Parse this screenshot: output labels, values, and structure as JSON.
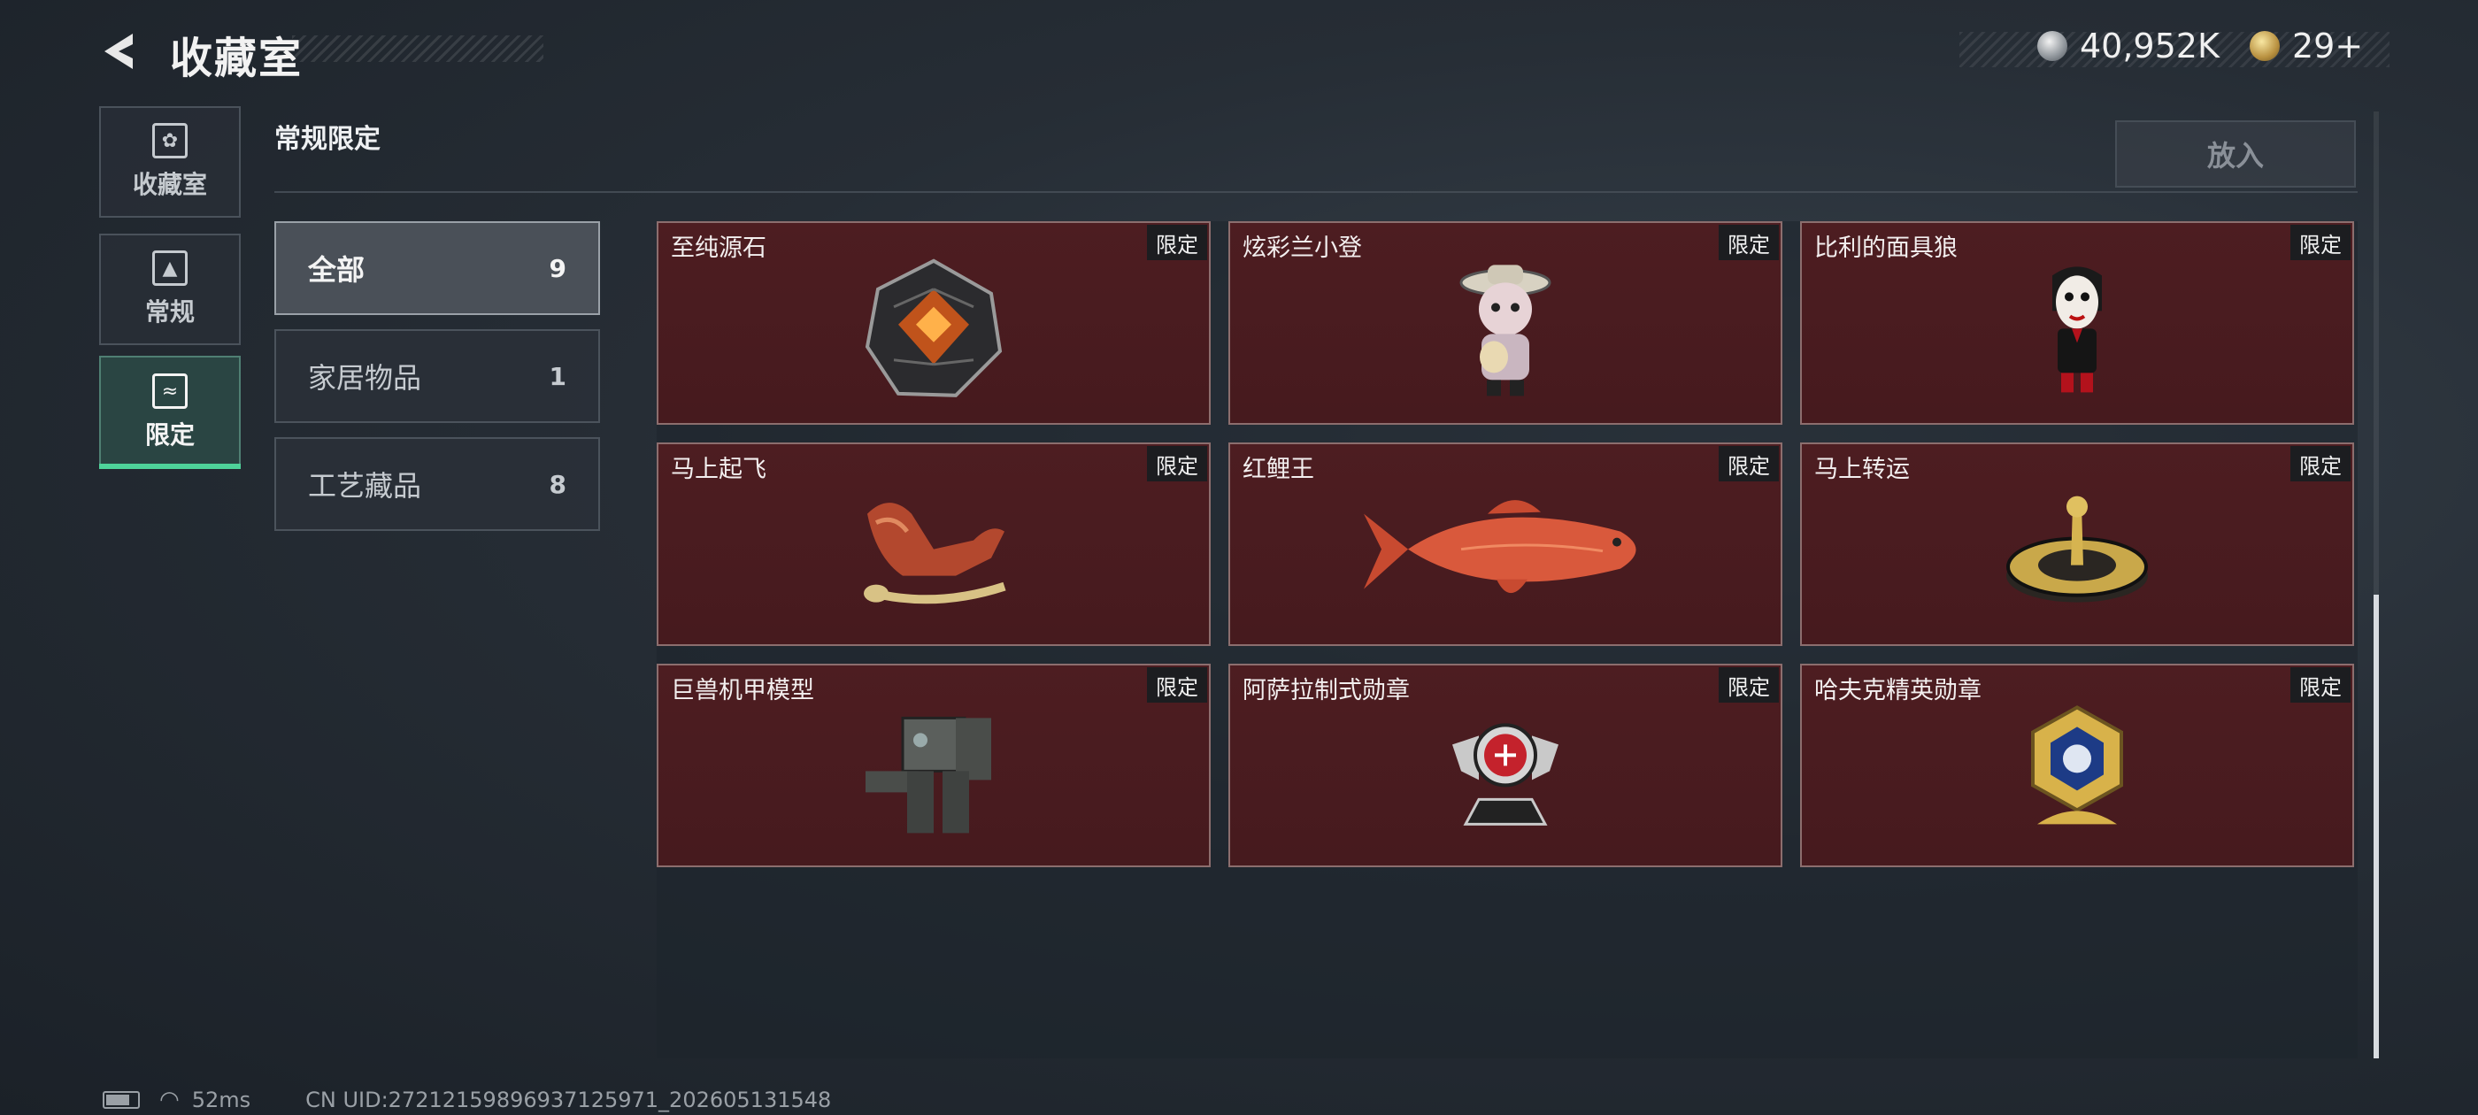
{
  "header": {
    "title": "收藏室"
  },
  "currency": [
    {
      "icon": "silver-coin-icon",
      "value": "40,952K"
    },
    {
      "icon": "gold-token-icon",
      "value": "29+"
    }
  ],
  "nav": [
    {
      "label": "收藏室",
      "icon": "collection-room-icon"
    },
    {
      "label": "常规",
      "icon": "regular-icon"
    },
    {
      "label": "限定",
      "icon": "limited-icon",
      "selected": true
    }
  ],
  "section": {
    "title": "常规限定",
    "place_button": "放入"
  },
  "categories": [
    {
      "label": "全部",
      "count": "9",
      "selected": true
    },
    {
      "label": "家居物品",
      "count": "1"
    },
    {
      "label": "工艺藏品",
      "count": "8"
    }
  ],
  "items": [
    {
      "name": "至纯源石",
      "badge": "限定",
      "art": "gem"
    },
    {
      "name": "炫彩兰小登",
      "badge": "限定",
      "art": "figure"
    },
    {
      "name": "比利的面具狼",
      "badge": "限定",
      "art": "puppet"
    },
    {
      "name": "马上起飞",
      "badge": "限定",
      "art": "horse"
    },
    {
      "name": "红鲤王",
      "badge": "限定",
      "art": "fish"
    },
    {
      "name": "马上转运",
      "badge": "限定",
      "art": "dial"
    },
    {
      "name": "巨兽机甲模型",
      "badge": "限定",
      "art": "mech"
    },
    {
      "name": "阿萨拉制式勋章",
      "badge": "限定",
      "art": "medal-red"
    },
    {
      "name": "哈夫克精英勋章",
      "badge": "限定",
      "art": "medal-gold"
    }
  ],
  "status_bar": {
    "ping": "52ms",
    "uid": "CN UID:27212159896937125971_202605131548"
  },
  "colors": {
    "card_bg": "#4b1c20",
    "accent_green": "#4ed39a",
    "badge_bg": "#1c1d20"
  }
}
